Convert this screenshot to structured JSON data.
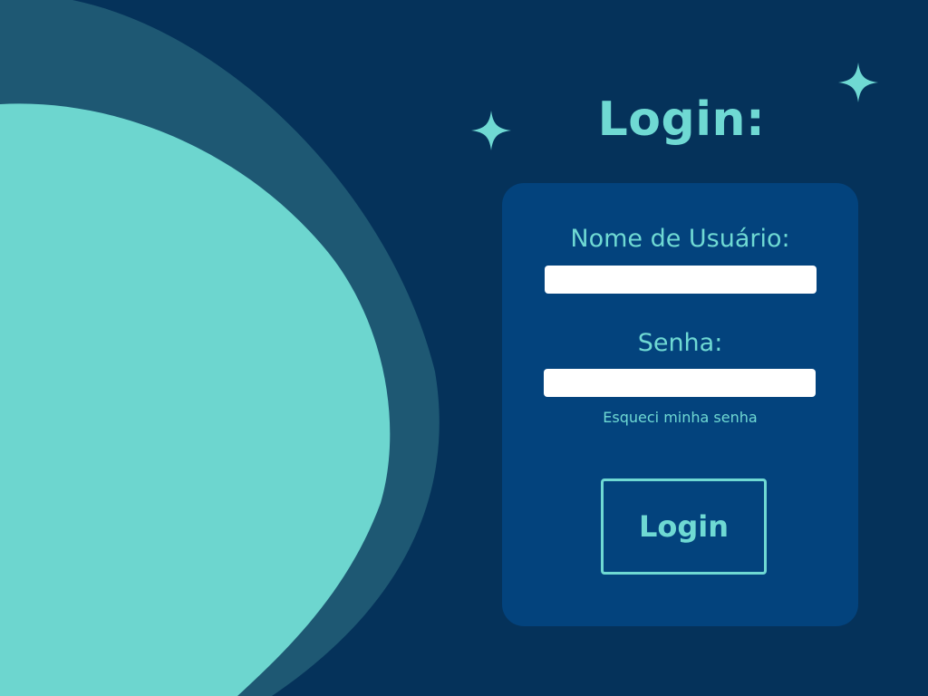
{
  "page": {
    "title": "Login:"
  },
  "form": {
    "username_label": "Nome de Usuário:",
    "username_value": "",
    "password_label": "Senha:",
    "password_value": "",
    "forgot_password_link": "Esqueci minha senha",
    "login_button": "Login"
  },
  "colors": {
    "background": "#05325a",
    "card": "#03437d",
    "accent": "#6fd9d3",
    "wave_dark": "#1e5873",
    "wave_light": "#6dd6cf",
    "field": "#ffffff"
  },
  "icons": {
    "left_sparkle": "sparkle-icon",
    "right_sparkle": "sparkle-icon"
  }
}
